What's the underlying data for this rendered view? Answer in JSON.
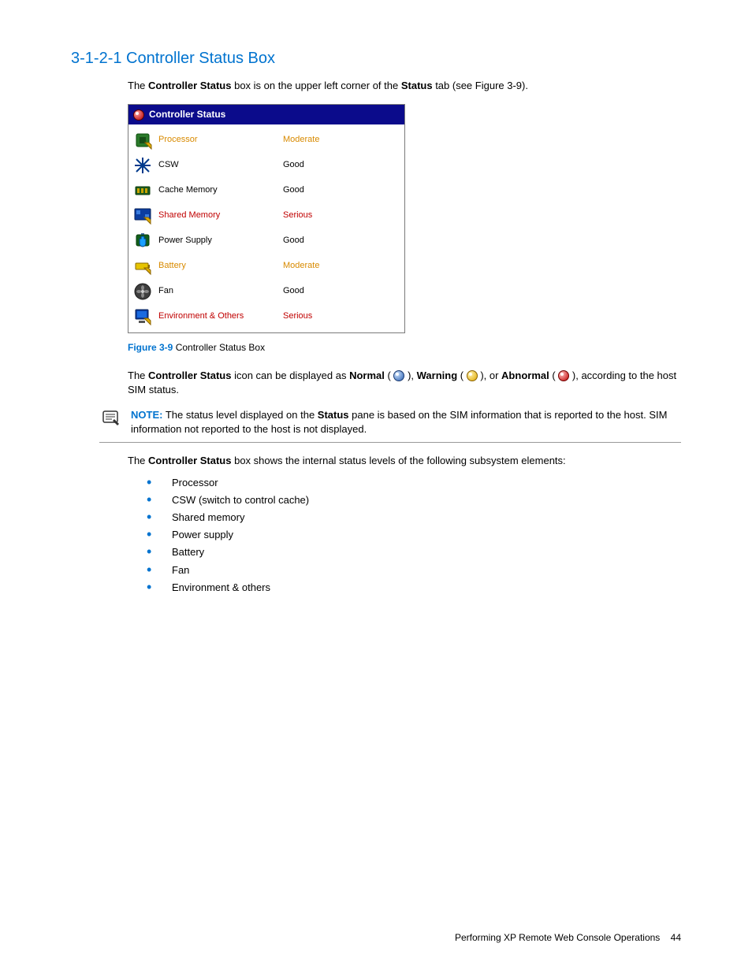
{
  "heading": "3-1-2-1 Controller Status Box",
  "intro": {
    "p1_a": "The ",
    "p1_b": "Controller Status",
    "p1_c": " box is on the upper left corner of the ",
    "p1_d": "Status",
    "p1_e": " tab (see Figure 3-9)."
  },
  "status_box": {
    "title": "Controller Status",
    "rows": [
      {
        "icon": "processor-icon",
        "label": "Processor",
        "value": "Moderate",
        "status": "moderate"
      },
      {
        "icon": "csw-icon",
        "label": "CSW",
        "value": "Good",
        "status": "good"
      },
      {
        "icon": "cache-memory-icon",
        "label": "Cache Memory",
        "value": "Good",
        "status": "good"
      },
      {
        "icon": "shared-memory-icon",
        "label": "Shared Memory",
        "value": "Serious",
        "status": "serious"
      },
      {
        "icon": "power-supply-icon",
        "label": "Power Supply",
        "value": "Good",
        "status": "good"
      },
      {
        "icon": "battery-icon",
        "label": "Battery",
        "value": "Moderate",
        "status": "moderate"
      },
      {
        "icon": "fan-icon",
        "label": "Fan",
        "value": "Good",
        "status": "good"
      },
      {
        "icon": "environment-icon",
        "label": "Environment & Others",
        "value": "Serious",
        "status": "serious"
      }
    ]
  },
  "figure": {
    "label": "Figure 3-9",
    "caption": " Controller Status Box"
  },
  "icon_para": {
    "a": "The ",
    "b": "Controller Status",
    "c": " icon can be displayed as ",
    "d": "Normal",
    "e": " ( ",
    "f": " ), ",
    "g": "Warning",
    "h": " ( ",
    "i": " ), or ",
    "j": "Abnormal",
    "k": " ( ",
    "l": " ), according to the host SIM status."
  },
  "note": {
    "label": "NOTE:",
    "text_a": "  The status level displayed on the ",
    "text_b": "Status",
    "text_c": " pane is based on the SIM information that is reported to the host. SIM information not reported to the host is not displayed."
  },
  "subsystems": {
    "intro_a": "The ",
    "intro_b": "Controller Status",
    "intro_c": " box shows the internal status levels of the following subsystem elements:",
    "items": [
      "Processor",
      "CSW (switch to control cache)",
      "Shared memory",
      "Power supply",
      "Battery",
      "Fan",
      "Environment & others"
    ]
  },
  "footer": {
    "text": "Performing XP Remote Web Console Operations",
    "page": "44"
  }
}
